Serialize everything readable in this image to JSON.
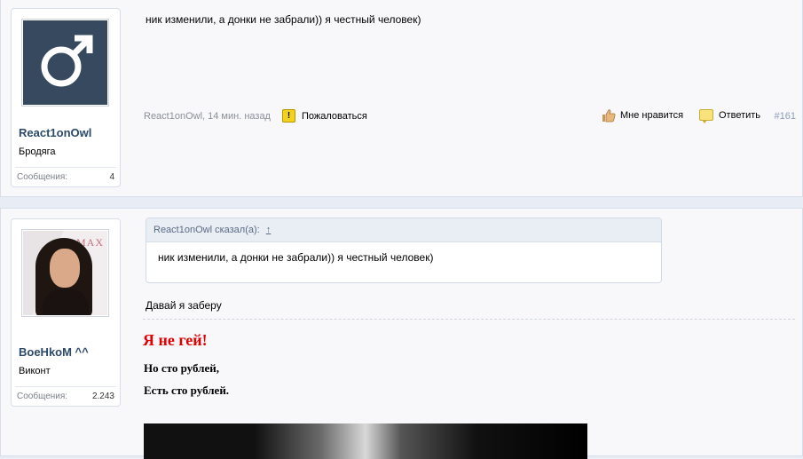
{
  "posts": [
    {
      "user": {
        "name": "React1onOwl",
        "title": "Бродяга",
        "messages_label": "Сообщения:",
        "messages_count": "4",
        "avatar_icon": "male-symbol-icon"
      },
      "message": "ник изменили, а донки не забрали)) я честный человек)",
      "meta": {
        "author_date": "React1onOwl, 14 мин. назад",
        "report": "Пожаловаться",
        "dislike": "Мне нравится",
        "reply": "Ответить",
        "permalink": "#161"
      }
    },
    {
      "user": {
        "name": "BoeHkoM ^^",
        "title": "Виконт",
        "messages_label": "Сообщения:",
        "messages_count": "2.243"
      },
      "quote": {
        "header": "React1onOwl сказал(а):",
        "arrow": "↑",
        "text": "ник изменили, а донки не забрали)) я честный человек)"
      },
      "message": "Давай я заберу",
      "signature": {
        "title": "Я не гей!",
        "line1": "Но сто рублей,",
        "line2": "Есть сто рублей."
      }
    }
  ],
  "colors": {
    "username": "#2b4969",
    "signature_title": "#e00000",
    "default_avatar_bg": "#36495f"
  }
}
